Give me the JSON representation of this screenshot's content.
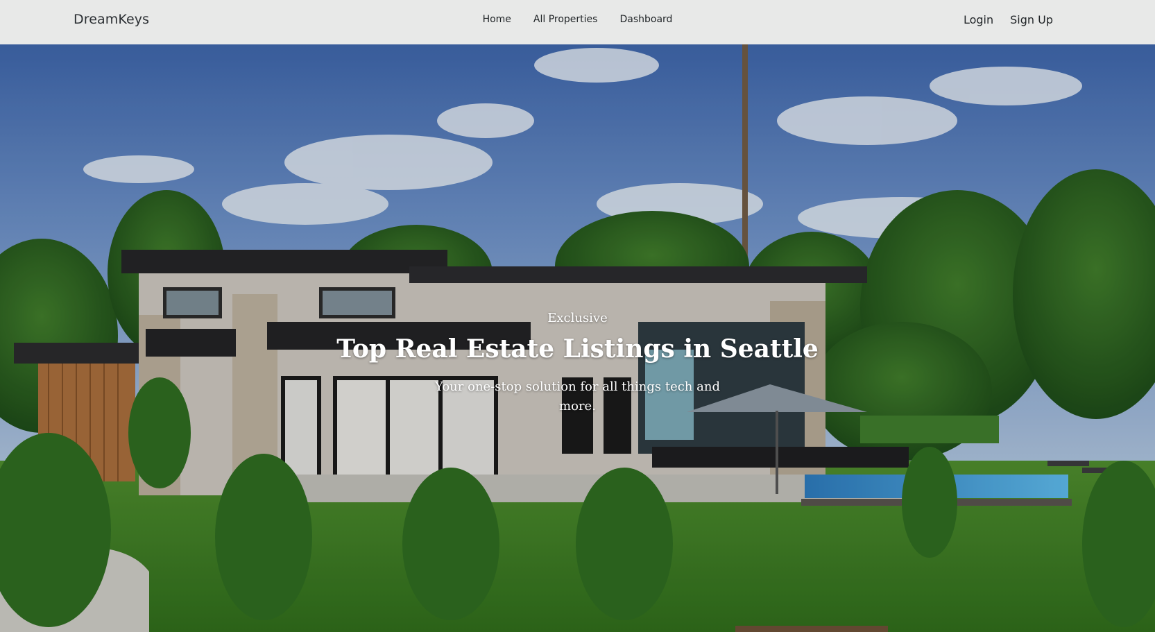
{
  "navbar": {
    "brand": "DreamKeys",
    "links": [
      "Home",
      "All Properties",
      "Dashboard"
    ],
    "auth": {
      "login": "Login",
      "signup": "Sign Up"
    }
  },
  "hero": {
    "eyebrow": "Exclusive",
    "title": "Top Real Estate Listings in Seattle",
    "subtitle": "Your one-stop solution for all things tech and more."
  },
  "colors": {
    "navbar_bg": "#e8e9e8",
    "text_dark": "#1f2326",
    "hero_text": "#ffffff"
  }
}
